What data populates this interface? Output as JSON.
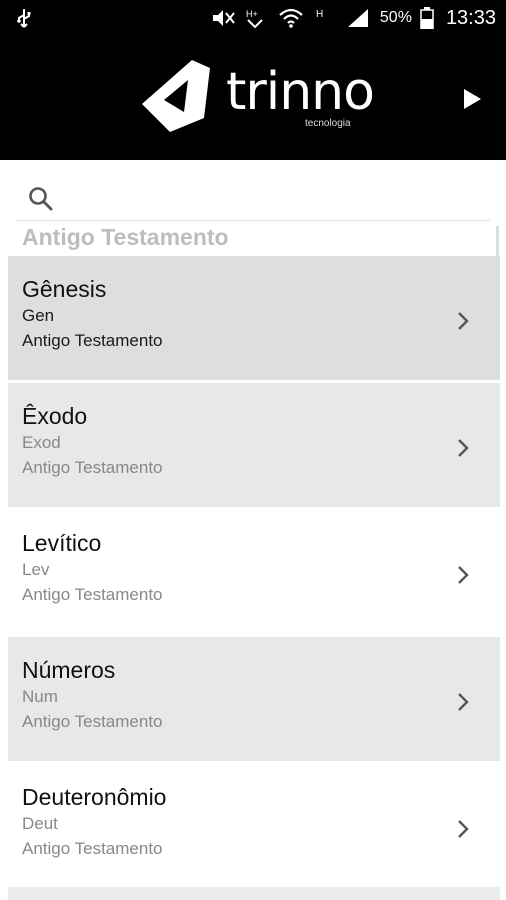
{
  "status_bar": {
    "battery_percent": "50%",
    "time": "13:33",
    "icons": [
      "usb-icon",
      "mute-icon",
      "hspa-icon",
      "wifi-icon",
      "h-icon",
      "signal-icon",
      "battery-icon"
    ]
  },
  "header": {
    "logo_word": "trinno",
    "logo_subtitle": "tecnologia",
    "next_icon": "play-icon"
  },
  "search": {
    "icon": "search-icon",
    "value": "",
    "placeholder": ""
  },
  "section_header": "Antigo Testamento",
  "books": [
    {
      "name": "Gênesis",
      "abbr": "Gen",
      "testament": "Antigo Testamento"
    },
    {
      "name": "Êxodo",
      "abbr": "Exod",
      "testament": "Antigo Testamento"
    },
    {
      "name": "Levítico",
      "abbr": "Lev",
      "testament": "Antigo Testamento"
    },
    {
      "name": "Números",
      "abbr": "Num",
      "testament": "Antigo Testamento"
    },
    {
      "name": "Deuteronômio",
      "abbr": "Deut",
      "testament": "Antigo Testamento"
    }
  ],
  "colors": {
    "header_bg": "#000000",
    "row_shade": "#e8e8e8",
    "row_selected": "#dedede"
  }
}
